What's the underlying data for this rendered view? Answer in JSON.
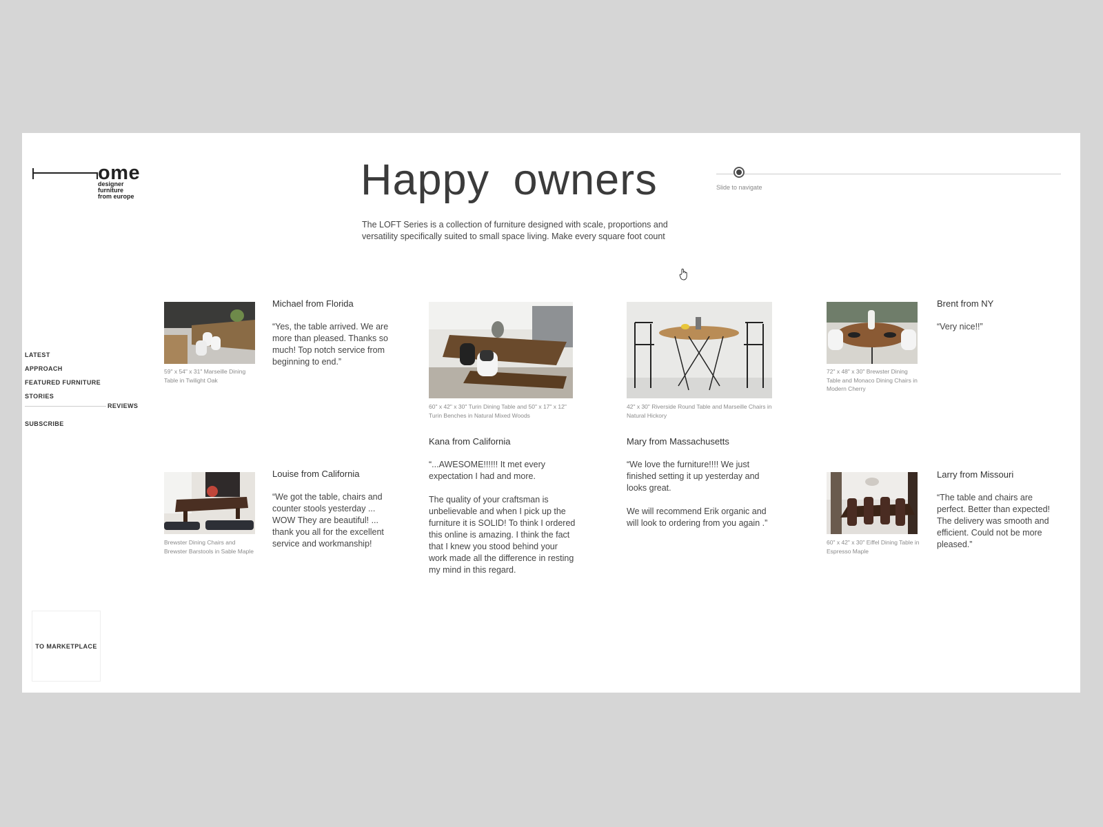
{
  "brand": {
    "logo_word": "ome",
    "tagline_1": "designer furniture",
    "tagline_2": "from europe"
  },
  "header": {
    "title": "Happy owners",
    "intro": "The LOFT Series is a collection of furniture designed with scale, proportions and versatility specifically suited to small space living. Make every square foot count"
  },
  "slider": {
    "hint": "Slide to navigate",
    "position": 0.05
  },
  "nav": {
    "items": [
      "LATEST",
      "APPROACH",
      "FEATURED FURNITURE",
      "STORIES"
    ],
    "active": "REVIEWS",
    "subscribe": "SUBSCRIBE"
  },
  "marketplace": {
    "label": "TO MARKETPLACE"
  },
  "reviews": [
    {
      "name": "Michael from Florida",
      "quote": "“Yes, the table arrived. We are more than pleased. Thanks so much! Top notch service from beginning to end.”",
      "caption": "59\" x 54\" x 31\" Marseille Dining Table in Twilight Oak"
    },
    {
      "name": "Kana from California",
      "quote": "“...AWESOME!!!!!! It met every expectation I had and more.\n\nThe quality of your craftsman is unbelievable and when I pick up the furniture it is SOLID! To think I ordered this online is amazing. I think the fact that I knew you stood behind your work made all the difference in resting my mind in this regard.",
      "caption": "60\" x 42\" x 30\" Turin Dining Table and 50\" x 17\" x 12\" Turin Benches in Natural Mixed Woods"
    },
    {
      "name": "Mary from Massachusetts",
      "quote": "“We love the furniture!!!! We just finished setting it up yesterday and looks great.\n\nWe will recommend Erik organic and will look to ordering from you again .”",
      "caption": "42\" x 30\" Riverside Round Table and Marseille Chairs in Natural Hickory"
    },
    {
      "name": "Brent from NY",
      "quote": "“Very nice!!”",
      "caption": "72\" x 48\" x 30\" Brewster Dining Table and Monaco Dining Chairs in Modern Cherry"
    },
    {
      "name": "Louise from California",
      "quote": "“We got the table, chairs and counter stools yesterday ... WOW They are beautiful! ... thank you all for the excellent service and workmanship!",
      "caption": "Brewster Dining Chairs and Brewster Barstools in Sable Maple"
    },
    {
      "name": "Larry from Missouri",
      "quote": "“The table and chairs are perfect. Better than expected! The delivery was smooth and efficient. Could not be more pleased.”",
      "caption": "60\" x 42\" x 30\" Eiffel Dining Table in Espresso Maple"
    }
  ]
}
